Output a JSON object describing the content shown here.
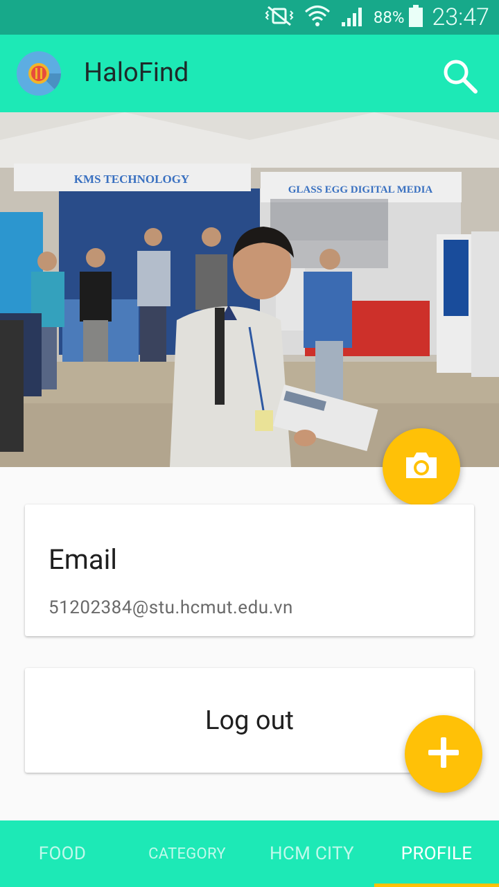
{
  "status_bar": {
    "battery_percent": "88%",
    "time": "23:47",
    "icons": [
      "vibrate-icon",
      "wifi-icon",
      "signal-icon",
      "battery-icon"
    ]
  },
  "app_bar": {
    "title": "HaloFind",
    "logo_icon": "restaurant-logo-icon",
    "search_icon": "search-icon"
  },
  "hero": {
    "banner_left": "KMS TECHNOLOGY",
    "banner_right": "GLASS EGG DIGITAL MEDIA"
  },
  "profile": {
    "email_label": "Email",
    "email_value": "51202384@stu.hcmut.edu.vn",
    "logout_label": "Log out"
  },
  "fabs": {
    "camera_icon": "camera-icon",
    "add_icon": "plus-icon"
  },
  "bottom_nav": {
    "tabs": [
      {
        "label": "FOOD"
      },
      {
        "label": "CATEGORY"
      },
      {
        "label": "HCM CITY"
      },
      {
        "label": "PROFILE"
      }
    ],
    "active_tab": "PROFILE"
  },
  "colors": {
    "primary": "#1de9b6",
    "primary_dark": "#17a98a",
    "accent": "#ffc107"
  }
}
